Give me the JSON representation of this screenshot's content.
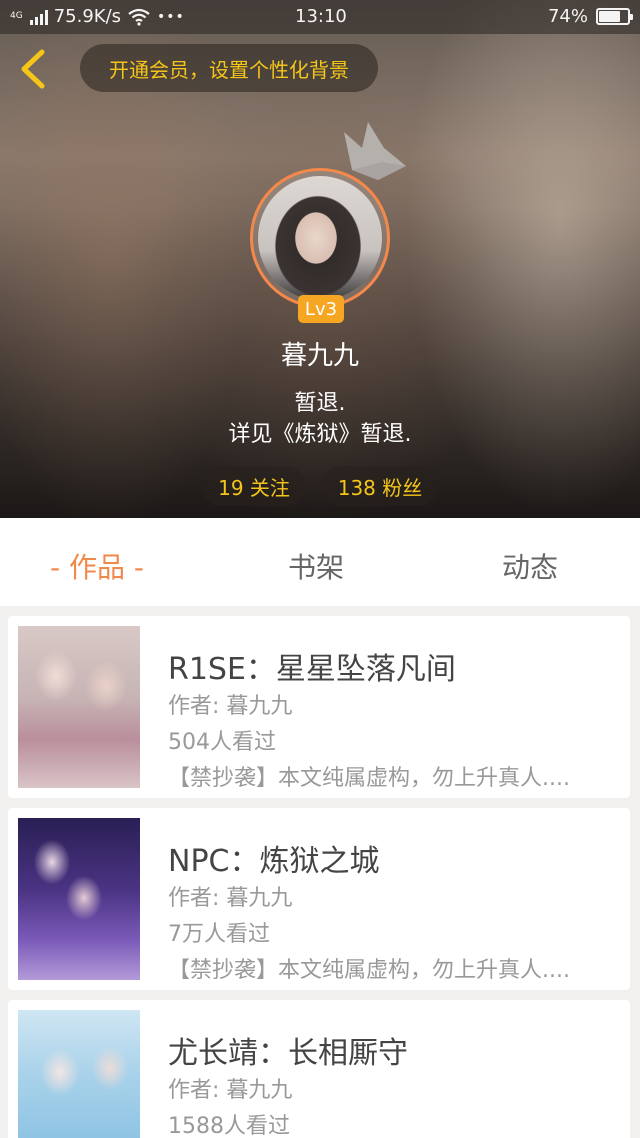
{
  "status_bar": {
    "network": "4G",
    "speed": "75.9K/s",
    "more": "•••",
    "time": "13:10",
    "battery": "74%"
  },
  "header": {
    "vip_prompt": "开通会员，设置个性化背景"
  },
  "profile": {
    "level": "Lv3",
    "username": "暮九九",
    "bio_line1": "暂退.",
    "bio_line2": "详见《炼狱》暂退.",
    "following": "19 关注",
    "fans": "138 粉丝"
  },
  "tabs": {
    "works": "- 作品 -",
    "shelf": "书架",
    "feed": "动态"
  },
  "books": [
    {
      "title": "R1SE：星星坠落凡间",
      "author": "作者: 暮九九",
      "views": "504人看过",
      "desc": "【禁抄袭】本文纯属虚构，勿上升真人...."
    },
    {
      "title": "NPC：炼狱之城",
      "author": "作者: 暮九九",
      "views": "7万人看过",
      "desc": "【禁抄袭】本文纯属虚构，勿上升真人...."
    },
    {
      "title": "尤长靖：长相厮守",
      "author": "作者: 暮九九",
      "views": "1588人看过",
      "desc": ""
    }
  ],
  "colors": {
    "accent_orange": "#f08a4b",
    "gold_text": "#f5c518",
    "level_badge": "#f5a623"
  }
}
